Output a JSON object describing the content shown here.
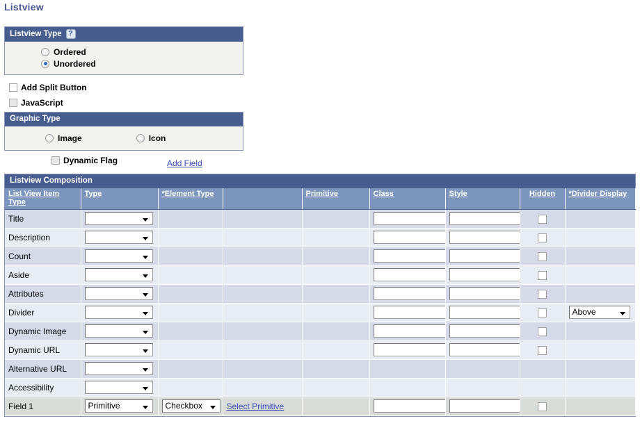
{
  "page": {
    "title": "Listview"
  },
  "listview_type": {
    "header": "Listview Type",
    "help_icon": "help-question-icon",
    "options": [
      {
        "label": "Ordered",
        "selected": false
      },
      {
        "label": "Unordered",
        "selected": true
      }
    ]
  },
  "checkboxes": {
    "add_split_button": {
      "label": "Add Split Button",
      "checked": false,
      "disabled": false
    },
    "javascript": {
      "label": "JavaScript",
      "checked": false,
      "disabled": true
    },
    "dynamic_flag": {
      "label": "Dynamic Flag",
      "checked": false,
      "disabled": true
    }
  },
  "graphic_type": {
    "header": "Graphic Type",
    "options": [
      {
        "label": "Image",
        "selected": false
      },
      {
        "label": "Icon",
        "selected": false
      }
    ]
  },
  "links": {
    "add_field": "Add Field",
    "select_primitive": "Select Primitive"
  },
  "grid": {
    "title": "Listview Composition",
    "columns": [
      {
        "label": "List View Item Type",
        "link": true,
        "align": "left"
      },
      {
        "label": "Type",
        "link": true,
        "align": "left"
      },
      {
        "label": "*Element Type",
        "link": true,
        "align": "left"
      },
      {
        "label": "",
        "link": false,
        "align": "left"
      },
      {
        "label": "Primitive",
        "link": true,
        "align": "left"
      },
      {
        "label": "Class",
        "link": true,
        "align": "left"
      },
      {
        "label": "Style",
        "link": true,
        "align": "left"
      },
      {
        "label": "Hidden",
        "link": true,
        "align": "center"
      },
      {
        "label": "*Divider Display",
        "link": true,
        "align": "left"
      }
    ],
    "rows": [
      {
        "item_type": "Title",
        "type": "",
        "type_select": true,
        "element_type": null,
        "primitive_link": false,
        "has_class": true,
        "class_value": "",
        "has_style": true,
        "style_value": "",
        "has_hidden": true,
        "hidden_checked": false,
        "divider": null
      },
      {
        "item_type": "Description",
        "type": "",
        "type_select": true,
        "element_type": null,
        "primitive_link": false,
        "has_class": true,
        "class_value": "",
        "has_style": true,
        "style_value": "",
        "has_hidden": true,
        "hidden_checked": false,
        "divider": null
      },
      {
        "item_type": "Count",
        "type": "",
        "type_select": true,
        "element_type": null,
        "primitive_link": false,
        "has_class": true,
        "class_value": "",
        "has_style": true,
        "style_value": "",
        "has_hidden": true,
        "hidden_checked": false,
        "divider": null
      },
      {
        "item_type": "Aside",
        "type": "",
        "type_select": true,
        "element_type": null,
        "primitive_link": false,
        "has_class": true,
        "class_value": "",
        "has_style": true,
        "style_value": "",
        "has_hidden": true,
        "hidden_checked": false,
        "divider": null
      },
      {
        "item_type": "Attributes",
        "type": "",
        "type_select": true,
        "element_type": null,
        "primitive_link": false,
        "has_class": true,
        "class_value": "",
        "has_style": true,
        "style_value": "",
        "has_hidden": true,
        "hidden_checked": false,
        "divider": null
      },
      {
        "item_type": "Divider",
        "type": "",
        "type_select": true,
        "element_type": null,
        "primitive_link": false,
        "has_class": true,
        "class_value": "",
        "has_style": true,
        "style_value": "",
        "has_hidden": true,
        "hidden_checked": false,
        "divider": "Above"
      },
      {
        "item_type": "Dynamic Image",
        "type": "",
        "type_select": true,
        "element_type": null,
        "primitive_link": false,
        "has_class": true,
        "class_value": "",
        "has_style": true,
        "style_value": "",
        "has_hidden": true,
        "hidden_checked": false,
        "divider": null
      },
      {
        "item_type": "Dynamic URL",
        "type": "",
        "type_select": true,
        "element_type": null,
        "primitive_link": false,
        "has_class": true,
        "class_value": "",
        "has_style": true,
        "style_value": "",
        "has_hidden": true,
        "hidden_checked": false,
        "divider": null
      },
      {
        "item_type": "Alternative URL",
        "type": "",
        "type_select": true,
        "element_type": null,
        "primitive_link": false,
        "has_class": false,
        "class_value": "",
        "has_style": false,
        "style_value": "",
        "has_hidden": false,
        "hidden_checked": false,
        "divider": null
      },
      {
        "item_type": "Accessibility",
        "type": "",
        "type_select": true,
        "element_type": null,
        "primitive_link": false,
        "has_class": false,
        "class_value": "",
        "has_style": false,
        "style_value": "",
        "has_hidden": false,
        "hidden_checked": false,
        "divider": null
      },
      {
        "item_type": "Field 1",
        "type": "Primitive",
        "type_select": true,
        "element_type": "Checkbox",
        "primitive_link": true,
        "has_class": true,
        "class_value": "",
        "has_style": true,
        "style_value": "",
        "has_hidden": true,
        "hidden_checked": false,
        "divider": null
      }
    ]
  },
  "colors": {
    "title_text": "#4a5896",
    "panel_header": "#475c8f",
    "grid_header": "#7b95bf",
    "row_odd": "#d4dae8",
    "row_even": "#e8ecf5",
    "row_last": "#d7dcd8",
    "link": "#3a4ab5"
  }
}
